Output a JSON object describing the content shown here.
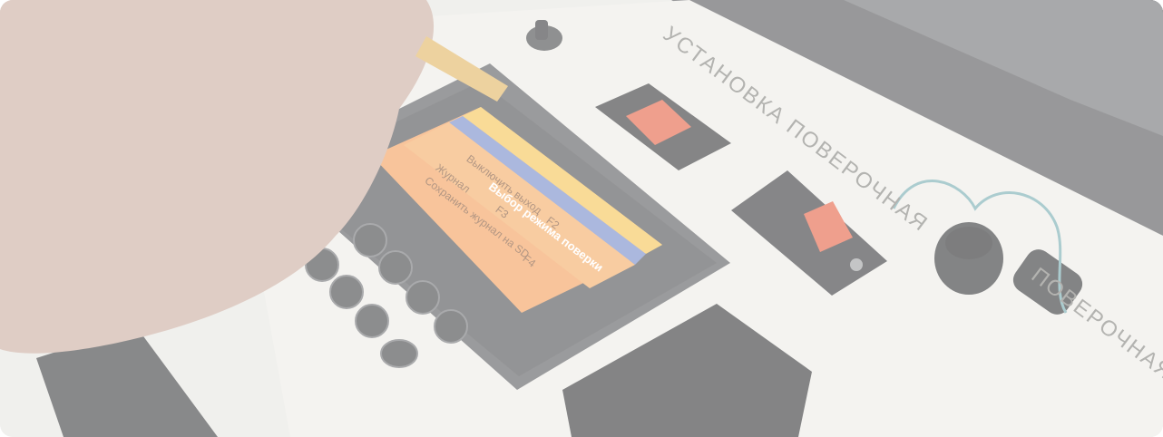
{
  "image": {
    "description_tag": "photo",
    "colors": {
      "background": "#e6e5e1",
      "device_body": "#5d5e5f",
      "screen_orange": "#f6a45a",
      "screen_header": "#f4c24d",
      "screen_blue": "#6f86c7",
      "indicator_red": "#e35a3c",
      "cable_teal": "#6fa7ad"
    }
  },
  "device_screen": {
    "header": "Выбор режима поверки",
    "menu_items": [
      {
        "label": "Выключить выход",
        "key": "F2"
      },
      {
        "label": "Журнал",
        "key": "F3"
      },
      {
        "label": "Сохранить журнал на SD",
        "key": "F4"
      }
    ]
  },
  "panel_text": {
    "title": "УСТАНОВКА ПОВЕРОЧНАЯ",
    "side_text": "ПОВЕРОЧНАЯ СПИ"
  },
  "keypad": {
    "button_icons": [
      "play-icon",
      "play-icon",
      "play-icon",
      "play-icon"
    ],
    "button_count": 8
  },
  "icons": [
    "key-switch-icon",
    "led-indicator-icon",
    "toggle-switch-icon",
    "probe-coil-icon"
  ]
}
